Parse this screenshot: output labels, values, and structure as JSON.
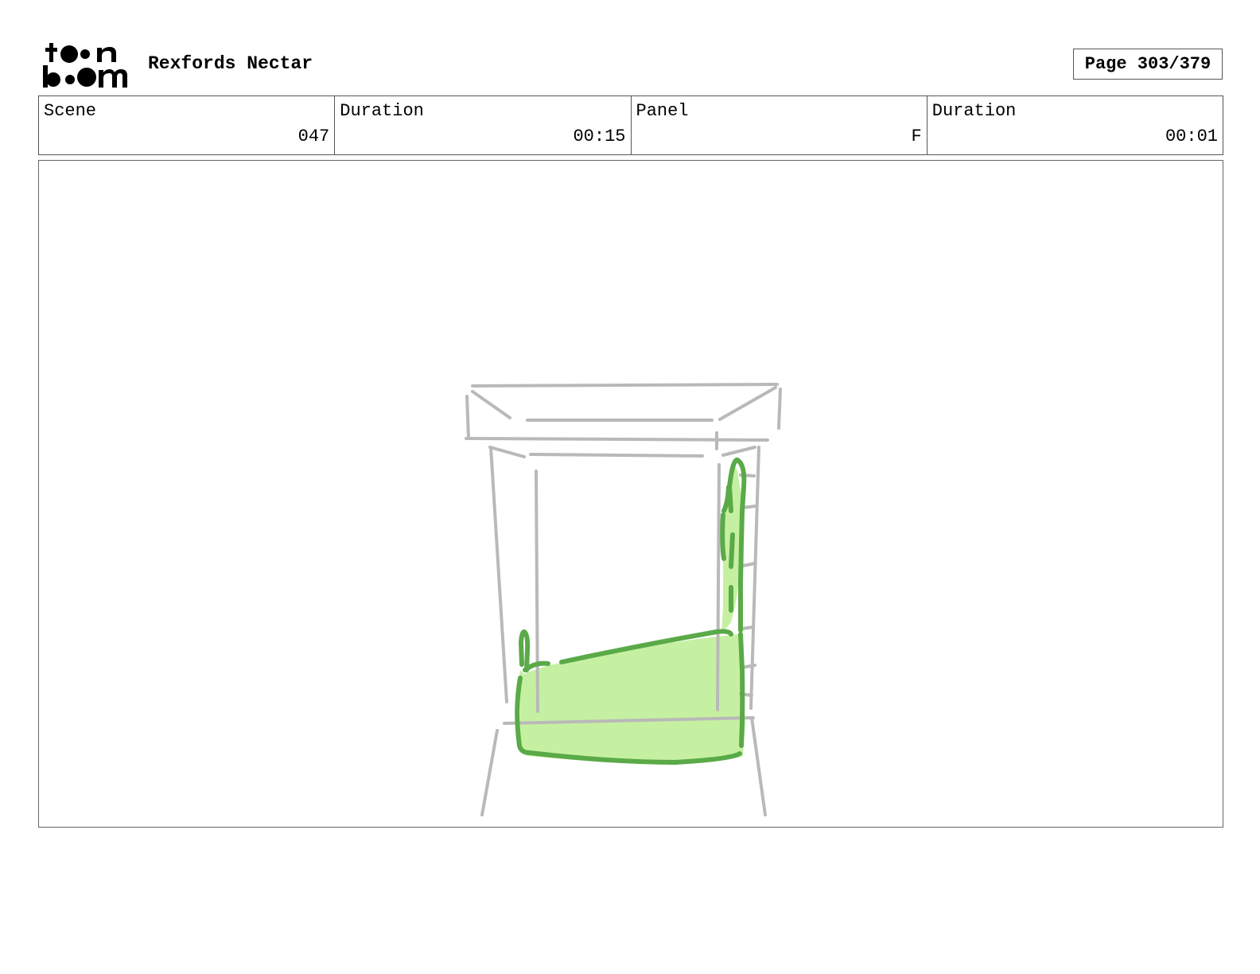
{
  "header": {
    "logo_name": "toon-boom-logo",
    "project_title": "Rexfords Nectar",
    "page_label": "Page 303/379"
  },
  "info_bar": {
    "scene_label": "Scene",
    "scene_value": "047",
    "scene_duration_label": "Duration",
    "scene_duration_value": "00:15",
    "panel_label": "Panel",
    "panel_value": "F",
    "panel_duration_label": "Duration",
    "panel_duration_value": "00:01"
  },
  "panel": {
    "drawing_subject": "blender-jar-sketch",
    "colors": {
      "sketch_line": "#b9b9b9",
      "liquid_fill": "#c6f0a1",
      "liquid_outline": "#5aaa48"
    }
  }
}
